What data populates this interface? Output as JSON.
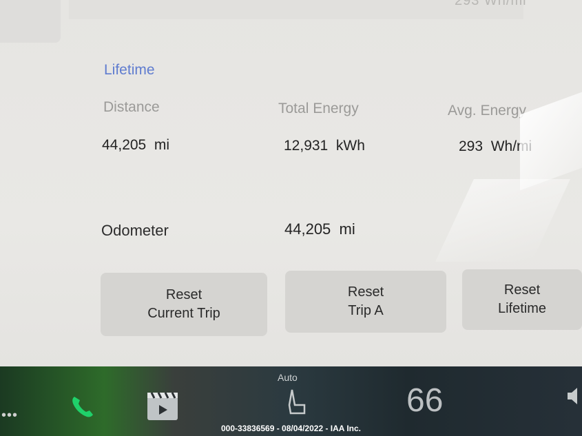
{
  "top": {
    "faded_text": "293 Wh/mi"
  },
  "lifetime": {
    "title": "Lifetime",
    "columns": [
      {
        "label": "Distance",
        "value": "44,205  mi"
      },
      {
        "label": "Total Energy",
        "value": "12,931  kWh"
      },
      {
        "label": "Avg. Energy",
        "value": "293  Wh/mi"
      }
    ],
    "odometer": {
      "label": "Odometer",
      "value": "44,205  mi"
    }
  },
  "buttons": [
    {
      "line1": "Reset",
      "line2": "Current Trip"
    },
    {
      "line1": "Reset",
      "line2": "Trip A"
    },
    {
      "line1": "Reset",
      "line2": "Lifetime"
    }
  ],
  "taskbar": {
    "dots": "•••",
    "seat_mode": "Auto",
    "temperature": "66",
    "icons": [
      "phone-icon",
      "media-icon",
      "seat-heater-icon",
      "speaker-icon"
    ],
    "phone_color": "#1fd16a"
  },
  "caption": "000-33836569 - 08/04/2022 - IAA Inc."
}
